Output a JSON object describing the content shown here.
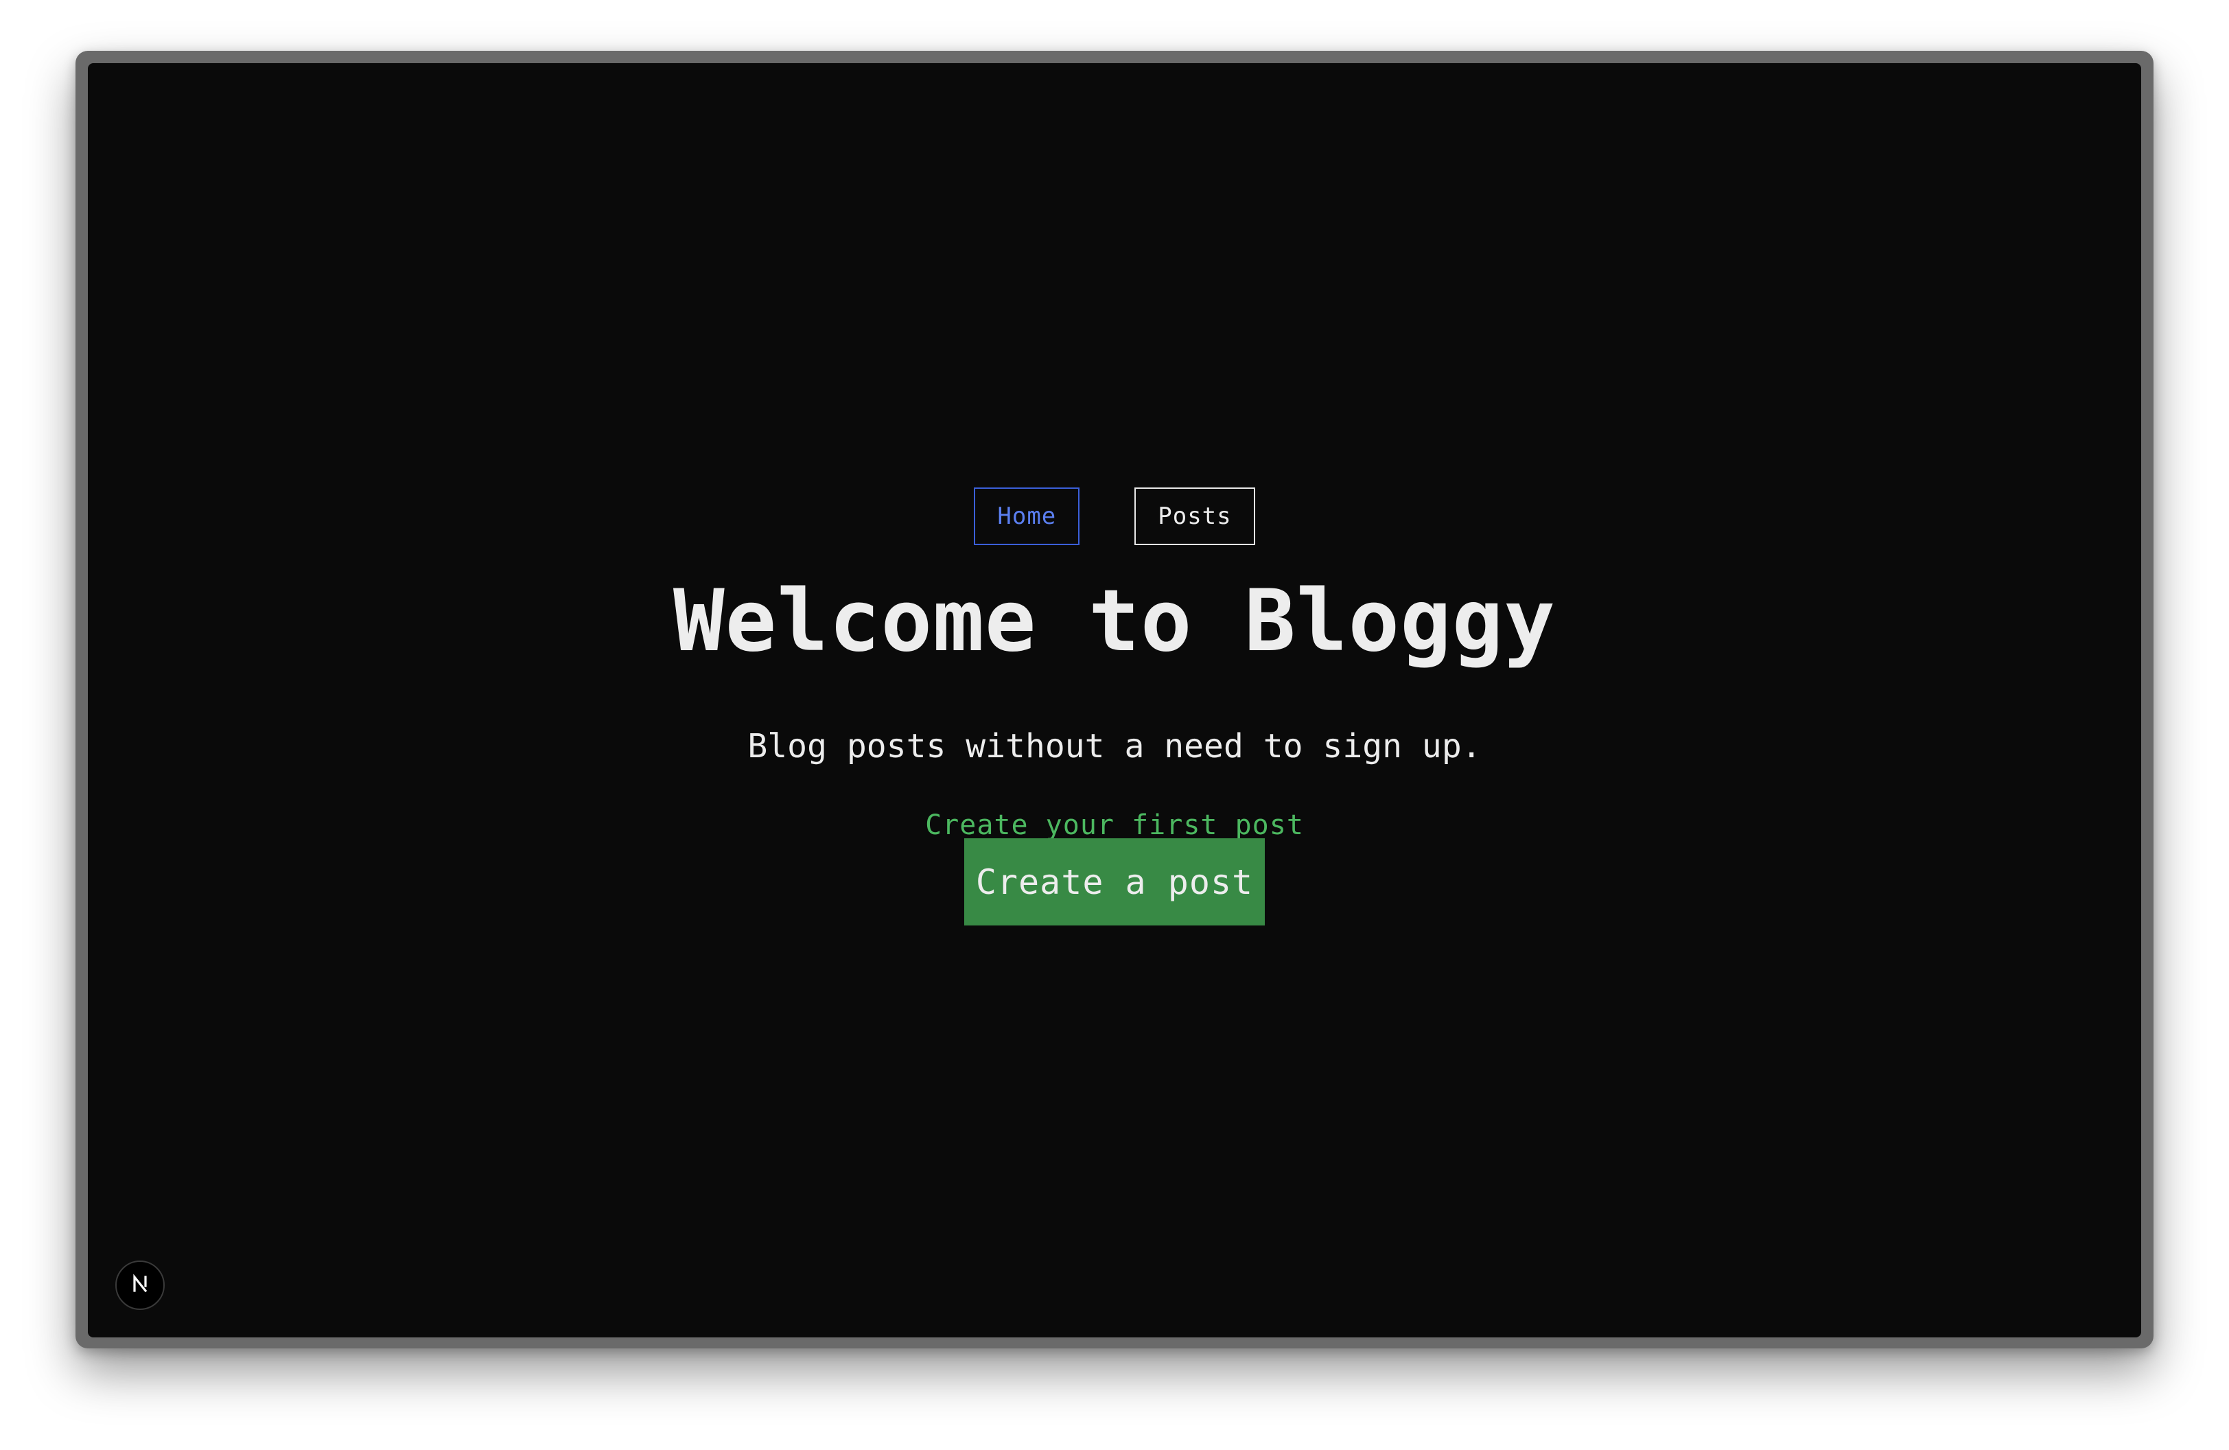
{
  "nav": {
    "items": [
      {
        "label": "Home",
        "active": true
      },
      {
        "label": "Posts",
        "active": false
      }
    ]
  },
  "hero": {
    "title": "Welcome to Bloggy",
    "subtitle": "Blog posts without a need to sign up.",
    "cta_hint": "Create your first post",
    "cta_button": "Create a post"
  },
  "dev_indicator": {
    "icon": "nextjs-logo-icon"
  },
  "colors": {
    "background": "#0a0a0a",
    "text": "#ededed",
    "nav_active": "#5b7ff0",
    "accent_green": "#4cb860",
    "button_green": "#388a45"
  }
}
